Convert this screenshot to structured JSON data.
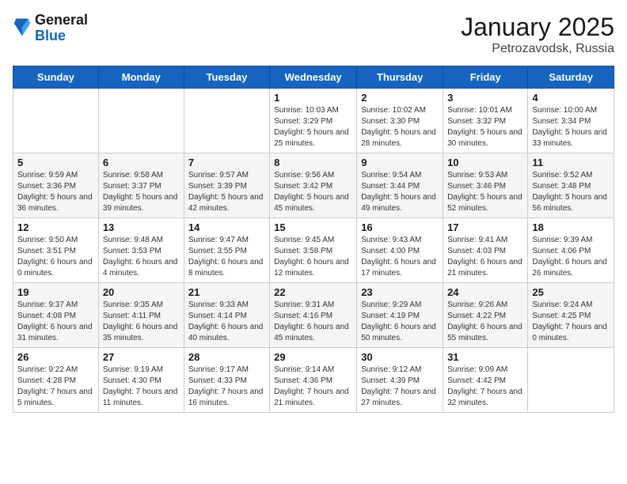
{
  "logo": {
    "general": "General",
    "blue": "Blue"
  },
  "header": {
    "month": "January 2025",
    "location": "Petrozavodsk, Russia"
  },
  "weekdays": [
    "Sunday",
    "Monday",
    "Tuesday",
    "Wednesday",
    "Thursday",
    "Friday",
    "Saturday"
  ],
  "weeks": [
    [
      {
        "day": "",
        "info": ""
      },
      {
        "day": "",
        "info": ""
      },
      {
        "day": "",
        "info": ""
      },
      {
        "day": "1",
        "info": "Sunrise: 10:03 AM\nSunset: 3:29 PM\nDaylight: 5 hours and 25 minutes."
      },
      {
        "day": "2",
        "info": "Sunrise: 10:02 AM\nSunset: 3:30 PM\nDaylight: 5 hours and 28 minutes."
      },
      {
        "day": "3",
        "info": "Sunrise: 10:01 AM\nSunset: 3:32 PM\nDaylight: 5 hours and 30 minutes."
      },
      {
        "day": "4",
        "info": "Sunrise: 10:00 AM\nSunset: 3:34 PM\nDaylight: 5 hours and 33 minutes."
      }
    ],
    [
      {
        "day": "5",
        "info": "Sunrise: 9:59 AM\nSunset: 3:36 PM\nDaylight: 5 hours and 36 minutes."
      },
      {
        "day": "6",
        "info": "Sunrise: 9:58 AM\nSunset: 3:37 PM\nDaylight: 5 hours and 39 minutes."
      },
      {
        "day": "7",
        "info": "Sunrise: 9:57 AM\nSunset: 3:39 PM\nDaylight: 5 hours and 42 minutes."
      },
      {
        "day": "8",
        "info": "Sunrise: 9:56 AM\nSunset: 3:42 PM\nDaylight: 5 hours and 45 minutes."
      },
      {
        "day": "9",
        "info": "Sunrise: 9:54 AM\nSunset: 3:44 PM\nDaylight: 5 hours and 49 minutes."
      },
      {
        "day": "10",
        "info": "Sunrise: 9:53 AM\nSunset: 3:46 PM\nDaylight: 5 hours and 52 minutes."
      },
      {
        "day": "11",
        "info": "Sunrise: 9:52 AM\nSunset: 3:48 PM\nDaylight: 5 hours and 56 minutes."
      }
    ],
    [
      {
        "day": "12",
        "info": "Sunrise: 9:50 AM\nSunset: 3:51 PM\nDaylight: 6 hours and 0 minutes."
      },
      {
        "day": "13",
        "info": "Sunrise: 9:48 AM\nSunset: 3:53 PM\nDaylight: 6 hours and 4 minutes."
      },
      {
        "day": "14",
        "info": "Sunrise: 9:47 AM\nSunset: 3:55 PM\nDaylight: 6 hours and 8 minutes."
      },
      {
        "day": "15",
        "info": "Sunrise: 9:45 AM\nSunset: 3:58 PM\nDaylight: 6 hours and 12 minutes."
      },
      {
        "day": "16",
        "info": "Sunrise: 9:43 AM\nSunset: 4:00 PM\nDaylight: 6 hours and 17 minutes."
      },
      {
        "day": "17",
        "info": "Sunrise: 9:41 AM\nSunset: 4:03 PM\nDaylight: 6 hours and 21 minutes."
      },
      {
        "day": "18",
        "info": "Sunrise: 9:39 AM\nSunset: 4:06 PM\nDaylight: 6 hours and 26 minutes."
      }
    ],
    [
      {
        "day": "19",
        "info": "Sunrise: 9:37 AM\nSunset: 4:08 PM\nDaylight: 6 hours and 31 minutes."
      },
      {
        "day": "20",
        "info": "Sunrise: 9:35 AM\nSunset: 4:11 PM\nDaylight: 6 hours and 35 minutes."
      },
      {
        "day": "21",
        "info": "Sunrise: 9:33 AM\nSunset: 4:14 PM\nDaylight: 6 hours and 40 minutes."
      },
      {
        "day": "22",
        "info": "Sunrise: 9:31 AM\nSunset: 4:16 PM\nDaylight: 6 hours and 45 minutes."
      },
      {
        "day": "23",
        "info": "Sunrise: 9:29 AM\nSunset: 4:19 PM\nDaylight: 6 hours and 50 minutes."
      },
      {
        "day": "24",
        "info": "Sunrise: 9:26 AM\nSunset: 4:22 PM\nDaylight: 6 hours and 55 minutes."
      },
      {
        "day": "25",
        "info": "Sunrise: 9:24 AM\nSunset: 4:25 PM\nDaylight: 7 hours and 0 minutes."
      }
    ],
    [
      {
        "day": "26",
        "info": "Sunrise: 9:22 AM\nSunset: 4:28 PM\nDaylight: 7 hours and 5 minutes."
      },
      {
        "day": "27",
        "info": "Sunrise: 9:19 AM\nSunset: 4:30 PM\nDaylight: 7 hours and 11 minutes."
      },
      {
        "day": "28",
        "info": "Sunrise: 9:17 AM\nSunset: 4:33 PM\nDaylight: 7 hours and 16 minutes."
      },
      {
        "day": "29",
        "info": "Sunrise: 9:14 AM\nSunset: 4:36 PM\nDaylight: 7 hours and 21 minutes."
      },
      {
        "day": "30",
        "info": "Sunrise: 9:12 AM\nSunset: 4:39 PM\nDaylight: 7 hours and 27 minutes."
      },
      {
        "day": "31",
        "info": "Sunrise: 9:09 AM\nSunset: 4:42 PM\nDaylight: 7 hours and 32 minutes."
      },
      {
        "day": "",
        "info": ""
      }
    ]
  ]
}
